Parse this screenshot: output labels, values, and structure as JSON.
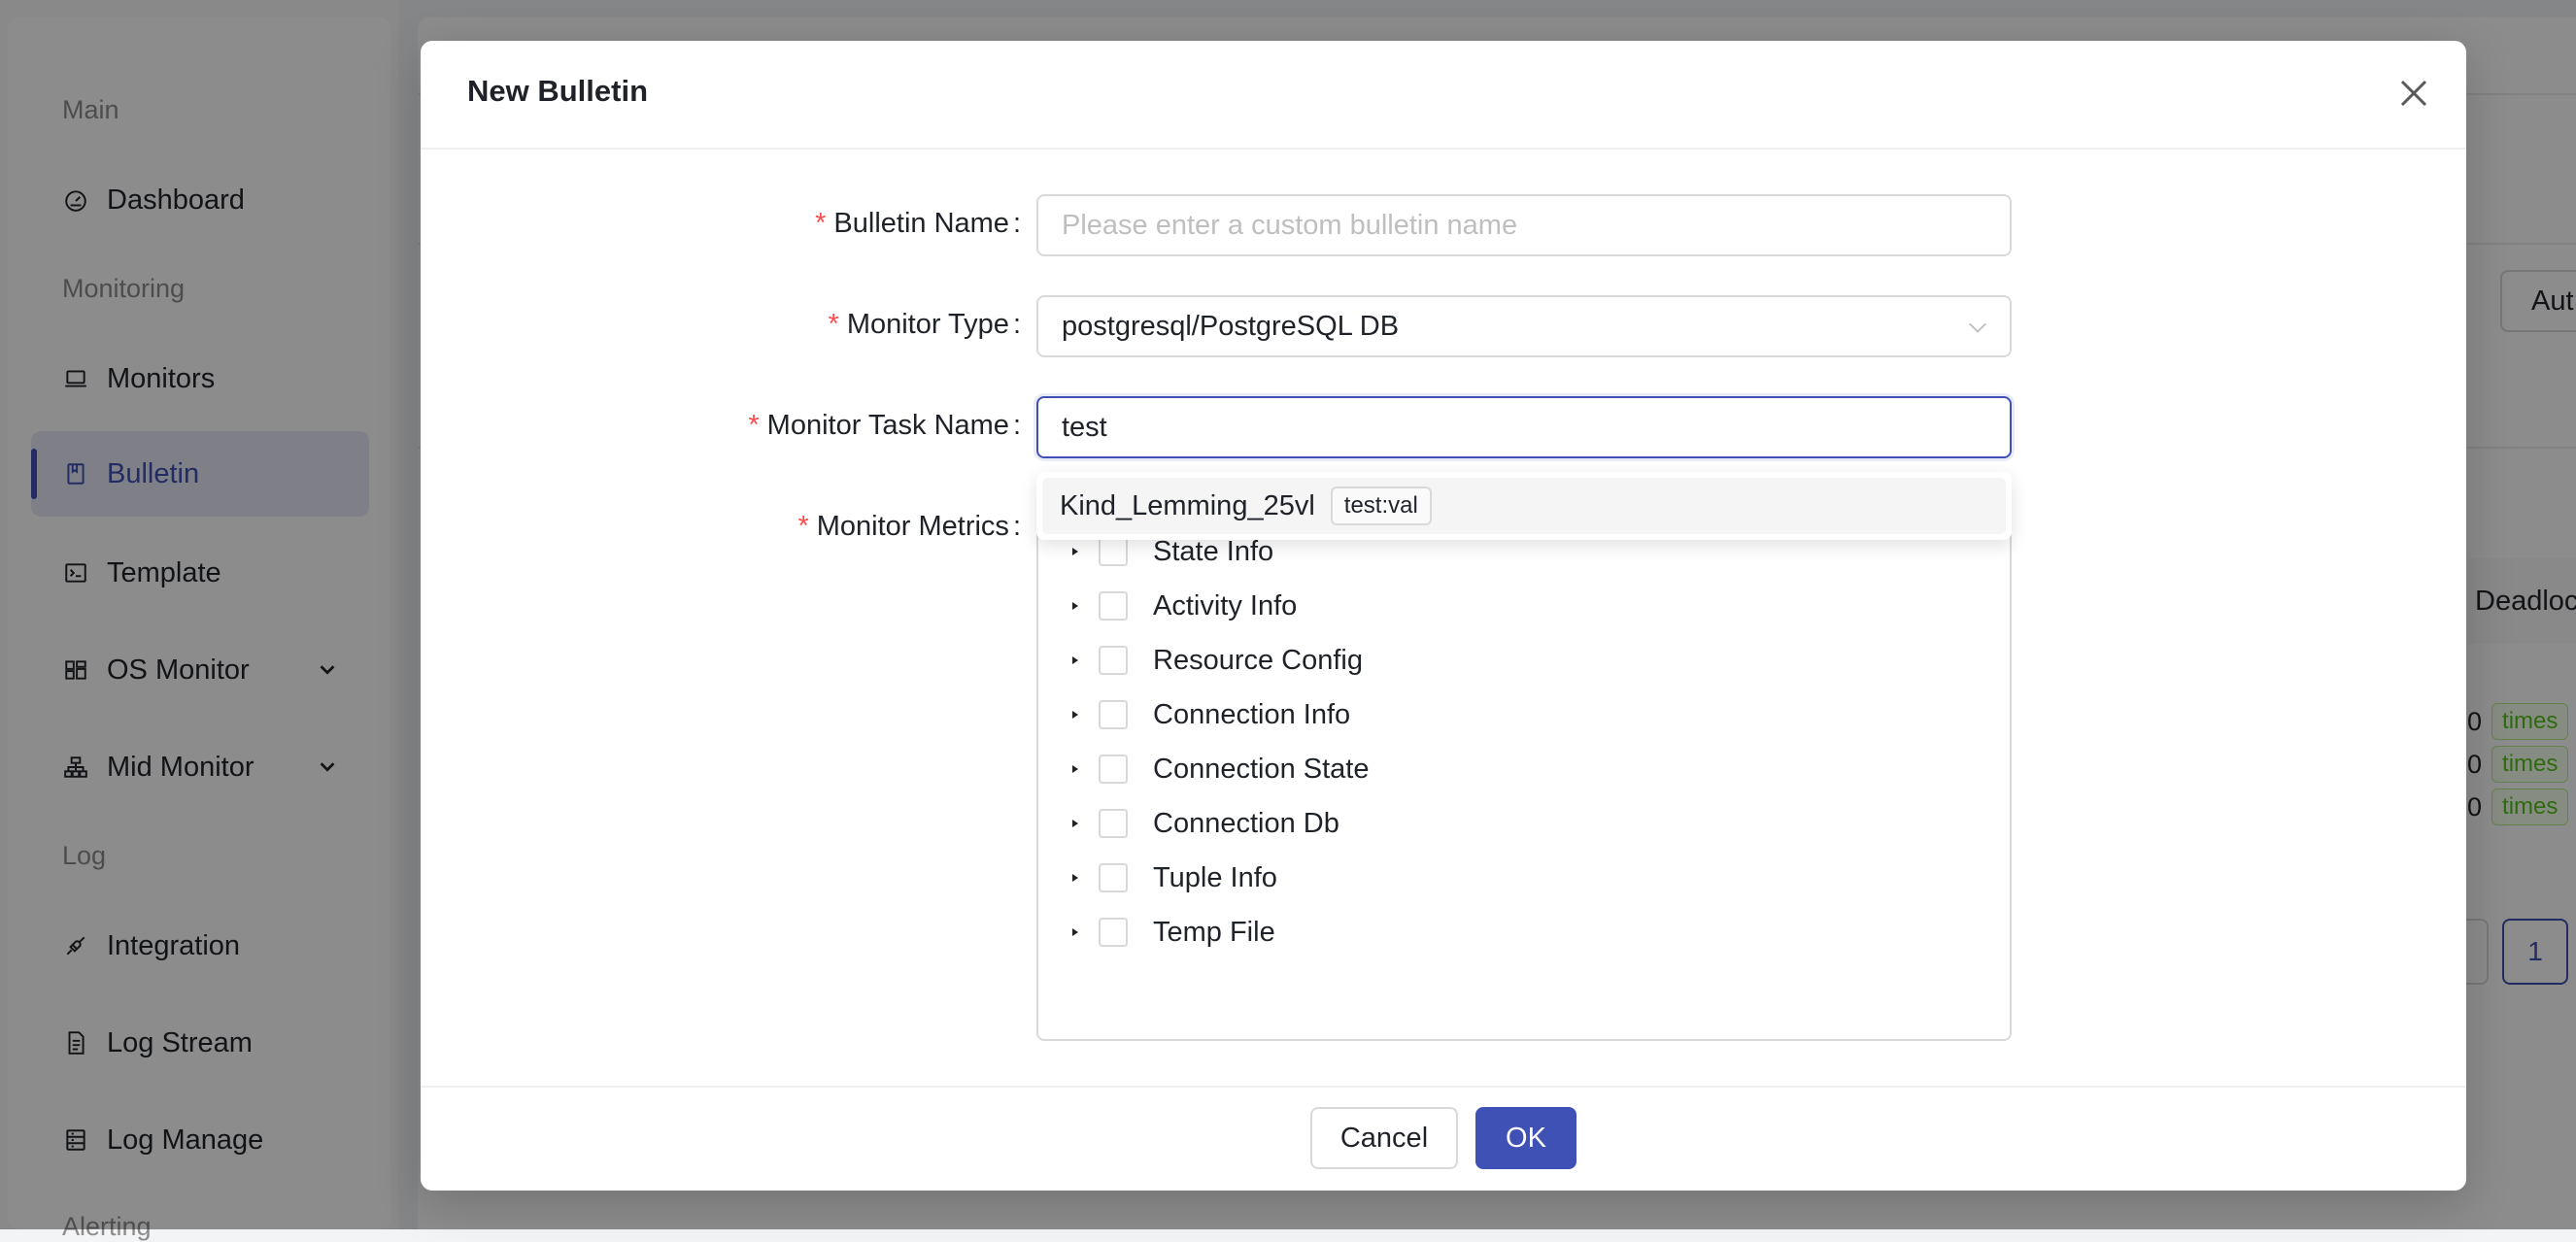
{
  "sidebar": {
    "groups": {
      "main": "Main",
      "monitoring": "Monitoring",
      "log": "Log",
      "alerting": "Alerting"
    },
    "items": [
      {
        "label": "Dashboard",
        "icon": "dashboard-icon"
      },
      {
        "label": "Monitors",
        "icon": "laptop-icon"
      },
      {
        "label": "Bulletin",
        "icon": "book-icon",
        "active": true
      },
      {
        "label": "Template",
        "icon": "code-icon"
      },
      {
        "label": "OS Monitor",
        "icon": "layout-icon"
      },
      {
        "label": "Mid Monitor",
        "icon": "cluster-icon"
      },
      {
        "label": "Integration",
        "icon": "api-icon"
      },
      {
        "label": "Log Stream",
        "icon": "file-text-icon"
      },
      {
        "label": "Log Manage",
        "icon": "database-icon"
      }
    ]
  },
  "background": {
    "top_button": "Aut",
    "table_header": "Deadloc",
    "rows": [
      {
        "value": "0",
        "tag": "times"
      },
      {
        "value": "0",
        "tag": "times"
      },
      {
        "value": "0",
        "tag": "times"
      }
    ],
    "page_current": "1"
  },
  "modal": {
    "title": "New Bulletin",
    "fields": {
      "bulletin_name": {
        "label": "Bulletin Name",
        "placeholder": "Please enter a custom bulletin name",
        "value": ""
      },
      "monitor_type": {
        "label": "Monitor Type",
        "value": "postgresql/PostgreSQL DB"
      },
      "monitor_task_name": {
        "label": "Monitor Task Name",
        "value": "test"
      },
      "monitor_metrics": {
        "label": "Monitor Metrics"
      }
    },
    "dropdown_option": {
      "label": "Kind_Lemming_25vl",
      "tag": "test:val"
    },
    "metrics": [
      "State Info",
      "Activity Info",
      "Resource Config",
      "Connection Info",
      "Connection State",
      "Connection Db",
      "Tuple Info",
      "Temp File"
    ],
    "cancel_label": "Cancel",
    "ok_label": "OK"
  },
  "colors": {
    "primary": "#3f51b5",
    "required": "#ff4d4f",
    "success": "#52c41a"
  }
}
